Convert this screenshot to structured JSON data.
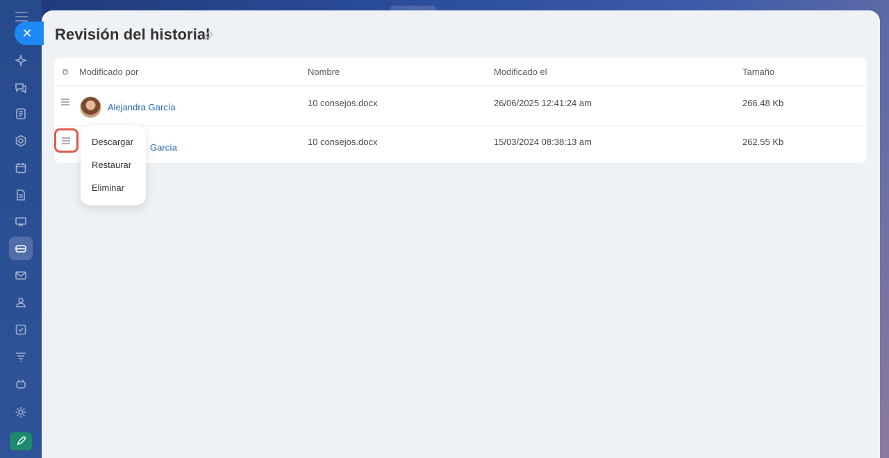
{
  "panel": {
    "title": "Revisión del historial"
  },
  "table": {
    "headers": {
      "modified_by": "Modificado por",
      "name": "Nombre",
      "modified_on": "Modificado el",
      "size": "Tamaño"
    },
    "rows": [
      {
        "user": "Alejandra García",
        "name": "10 consejos.docx",
        "modified_on": "26/06/2025 12:41:24 am",
        "size": "266.48 Kb"
      },
      {
        "user": "García",
        "name": "10 consejos.docx",
        "modified_on": "15/03/2024 08:38:13 am",
        "size": "262.55 Kb"
      }
    ]
  },
  "context_menu": {
    "items": [
      "Descargar",
      "Restaurar",
      "Eliminar"
    ]
  },
  "sidebar": {
    "close_symbol": "✕",
    "icons": [
      "sparkle-icon",
      "chat-icon",
      "feed-icon",
      "hexagon-icon",
      "calendar-icon",
      "document-icon",
      "presentation-icon",
      "drive-icon",
      "mail-icon",
      "contacts-icon",
      "tasks-icon",
      "filter-icon",
      "robot-icon",
      "settings-icon",
      "rocket-icon"
    ]
  },
  "colors": {
    "accent": "#1e88f5",
    "link": "#2067b0",
    "highlight_border": "#e05b4f",
    "panel_bg": "#eef2f4"
  }
}
